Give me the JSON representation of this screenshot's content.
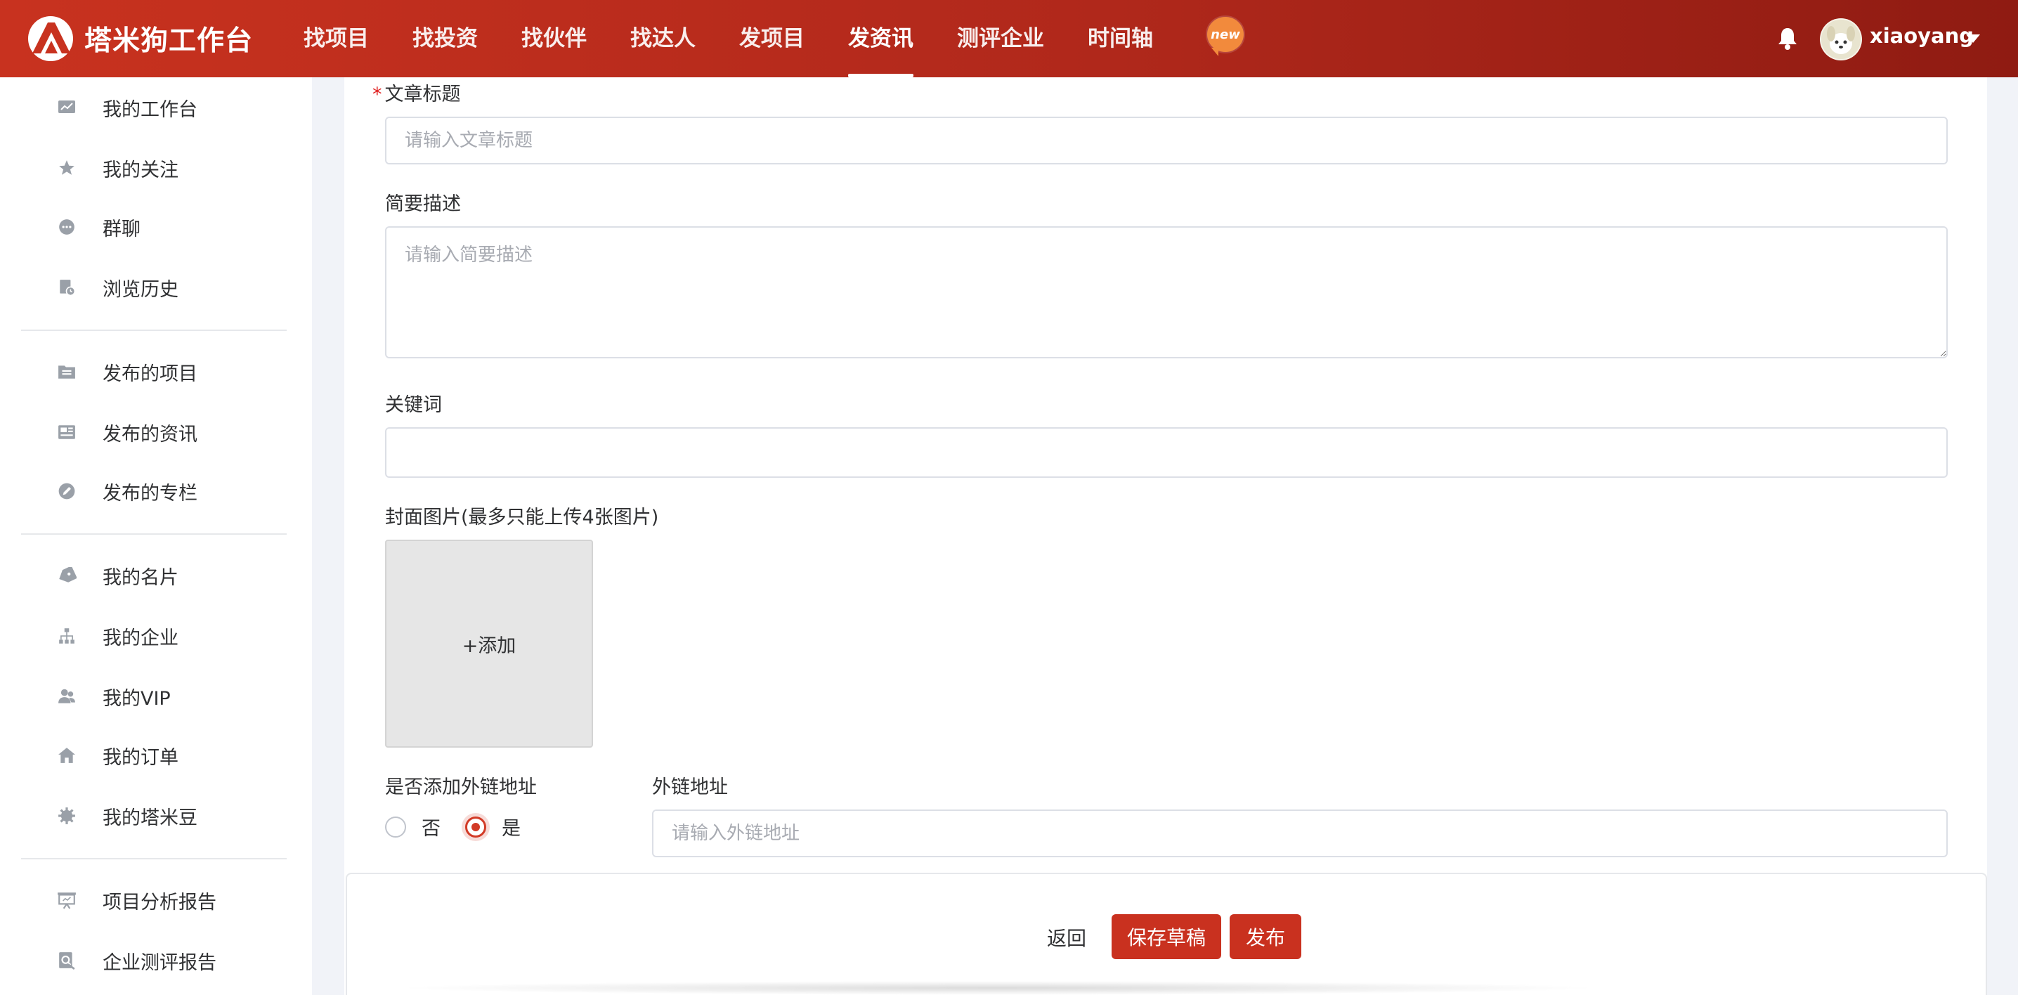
{
  "brand": {
    "name": "塔米狗工作台"
  },
  "nav": {
    "items": [
      "找项目",
      "找投资",
      "找伙伴",
      "找达人",
      "发项目",
      "发资讯",
      "测评企业",
      "时间轴"
    ],
    "active": "发资讯",
    "new_badge": "new"
  },
  "user": {
    "name": "xiaoyang"
  },
  "sidebar": {
    "groups": [
      [
        {
          "label": "我的工作台",
          "icon": "chart-icon"
        },
        {
          "label": "我的关注",
          "icon": "star-icon"
        },
        {
          "label": "群聊",
          "icon": "chat-icon"
        },
        {
          "label": "浏览历史",
          "icon": "history-icon"
        }
      ],
      [
        {
          "label": "发布的项目",
          "icon": "folder-list-icon"
        },
        {
          "label": "发布的资讯",
          "icon": "news-icon"
        },
        {
          "label": "发布的专栏",
          "icon": "pen-circle-icon"
        }
      ],
      [
        {
          "label": "我的名片",
          "icon": "tag-icon"
        },
        {
          "label": "我的企业",
          "icon": "org-chart-icon"
        },
        {
          "label": "我的VIP",
          "icon": "users-icon"
        },
        {
          "label": "我的订单",
          "icon": "home-icon"
        },
        {
          "label": "我的塔米豆",
          "icon": "gear-icon"
        }
      ],
      [
        {
          "label": "项目分析报告",
          "icon": "presentation-icon"
        },
        {
          "label": "企业测评报告",
          "icon": "report-search-icon"
        }
      ]
    ]
  },
  "form": {
    "title_label": "文章标题",
    "title_required_mark": "*",
    "title_placeholder": "请输入文章标题",
    "title_value": "",
    "desc_label": "简要描述",
    "desc_placeholder": "请输入简要描述",
    "desc_value": "",
    "keywords_label": "关键词",
    "keywords_value": "",
    "cover_label": "封面图片(最多只能上传4张图片)",
    "cover_add": "+添加",
    "link_toggle_label": "是否添加外链地址",
    "link_options": [
      "否",
      "是"
    ],
    "link_selected": "是",
    "link_label": "外链地址",
    "link_placeholder": "请输入外链地址",
    "link_value": ""
  },
  "actions": {
    "back": "返回",
    "save_draft": "保存草稿",
    "publish": "发布"
  },
  "colors": {
    "primary": "#c9311f",
    "topbar_start": "#c8321f",
    "topbar_end": "#8f1b12",
    "badge": "#f28a3c"
  }
}
